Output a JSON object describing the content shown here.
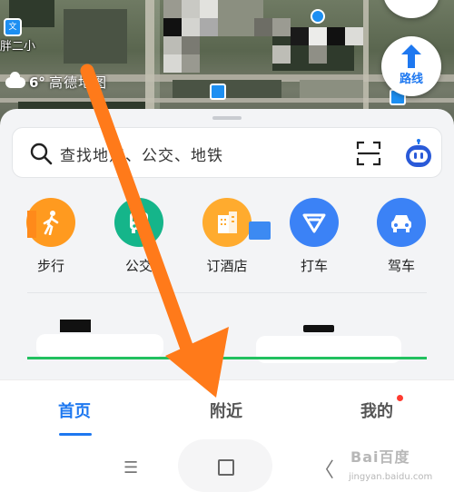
{
  "map": {
    "school_label": "胖二小",
    "weather_temp": "6°",
    "amap_logo": "高德地图",
    "route_label": "路线",
    "poi_glyph": "文"
  },
  "search": {
    "placeholder": "查找地点、公交、地铁"
  },
  "quick_actions": [
    {
      "label": "步行",
      "icon": "walk-icon",
      "color": "#ff9a1f"
    },
    {
      "label": "公交",
      "icon": "bus-icon",
      "color": "#15b58a"
    },
    {
      "label": "订酒店",
      "icon": "hotel-icon",
      "color": "#ffab2e"
    },
    {
      "label": "打车",
      "icon": "taxi-icon",
      "color": "#3b82f6"
    },
    {
      "label": "驾车",
      "icon": "car-icon",
      "color": "#3b82f6"
    }
  ],
  "tabs": [
    {
      "label": "首页",
      "active": true
    },
    {
      "label": "附近",
      "active": false
    },
    {
      "label": "我的",
      "active": false
    }
  ],
  "system_nav": {
    "menu_glyph": "☰",
    "back_glyph": "〈"
  },
  "watermark": {
    "main": "Bai百度",
    "sub": "jingyan.baidu.com"
  },
  "colors": {
    "accent": "#1e78f0",
    "annotation_arrow": "#ff7a1a",
    "badge_red": "#ff3b30"
  }
}
